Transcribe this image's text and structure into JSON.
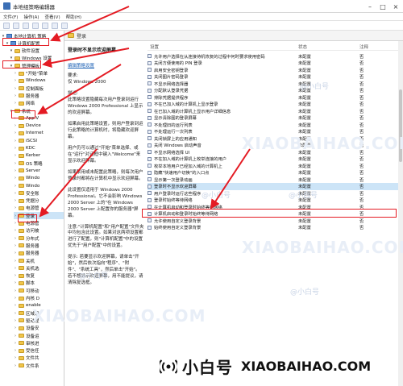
{
  "window": {
    "title": "本地组策略编辑器"
  },
  "menu": [
    "文件(F)",
    "操作(A)",
    "查看(V)",
    "帮助(H)"
  ],
  "tree": {
    "items": [
      {
        "label": "本地计算机 策略",
        "icon": "computer-icon",
        "indent": 0
      },
      {
        "label": "计算机配置",
        "icon": "computer-icon",
        "indent": 1
      },
      {
        "label": "软件设置",
        "icon": "folder-icon",
        "indent": 2
      },
      {
        "label": "Windows 设置",
        "icon": "folder-icon",
        "indent": 2
      },
      {
        "label": "管理模板",
        "icon": "folder-icon",
        "indent": 2
      },
      {
        "label": "\"开始\"菜单",
        "icon": "folder-icon",
        "indent": 3
      },
      {
        "label": "Windows",
        "icon": "folder-icon",
        "indent": 3
      },
      {
        "label": "控制面板",
        "icon": "folder-icon",
        "indent": 3
      },
      {
        "label": "服务器",
        "icon": "folder-icon",
        "indent": 3
      },
      {
        "label": "网络",
        "icon": "folder-icon",
        "indent": 3
      },
      {
        "label": "系统",
        "icon": "folder-icon",
        "indent": 2
      },
      {
        "label": "App-V",
        "icon": "folder-icon",
        "indent": 3
      },
      {
        "label": "Device",
        "icon": "folder-icon",
        "indent": 3
      },
      {
        "label": "Internet",
        "icon": "folder-icon",
        "indent": 3
      },
      {
        "label": "iSCSI",
        "icon": "folder-icon",
        "indent": 3
      },
      {
        "label": "KDC",
        "icon": "folder-icon",
        "indent": 3
      },
      {
        "label": "Kerber",
        "icon": "folder-icon",
        "indent": 3
      },
      {
        "label": "OS 策略",
        "icon": "folder-icon",
        "indent": 3
      },
      {
        "label": "Server",
        "icon": "folder-icon",
        "indent": 3
      },
      {
        "label": "Windo",
        "icon": "folder-icon",
        "indent": 3
      },
      {
        "label": "Windo",
        "icon": "folder-icon",
        "indent": 3
      },
      {
        "label": "安全账",
        "icon": "folder-icon",
        "indent": 3
      },
      {
        "label": "凭据分",
        "icon": "folder-icon",
        "indent": 3
      },
      {
        "label": "电源管",
        "icon": "folder-icon",
        "indent": 3
      },
      {
        "label": "登录",
        "icon": "folder-icon",
        "indent": 3
      },
      {
        "label": "电源管",
        "icon": "folder-icon",
        "indent": 3
      },
      {
        "label": "访问被",
        "icon": "folder-icon",
        "indent": 3
      },
      {
        "label": "分布式",
        "icon": "folder-icon",
        "indent": 3
      },
      {
        "label": "服务器",
        "icon": "folder-icon",
        "indent": 3
      },
      {
        "label": "服务器",
        "icon": "folder-icon",
        "indent": 3
      },
      {
        "label": "关机",
        "icon": "folder-icon",
        "indent": 3
      },
      {
        "label": "关机选",
        "icon": "folder-icon",
        "indent": 3
      },
      {
        "label": "恢复",
        "icon": "folder-icon",
        "indent": 3
      },
      {
        "label": "脚本",
        "icon": "folder-icon",
        "indent": 3
      },
      {
        "label": "可移动",
        "icon": "folder-icon",
        "indent": 3
      },
      {
        "label": "内核 D",
        "icon": "folder-icon",
        "indent": 3
      },
      {
        "label": "enable",
        "icon": "folder-icon",
        "indent": 3
      },
      {
        "label": "区域设",
        "icon": "folder-icon",
        "indent": 3
      },
      {
        "label": "驱动程",
        "icon": "folder-icon",
        "indent": 3
      },
      {
        "label": "设备安",
        "icon": "folder-icon",
        "indent": 3
      },
      {
        "label": "设备运",
        "icon": "folder-icon",
        "indent": 3
      },
      {
        "label": "审核进",
        "icon": "folder-icon",
        "indent": 3
      },
      {
        "label": "受信任",
        "icon": "folder-icon",
        "indent": 3
      },
      {
        "label": "文件共",
        "icon": "folder-icon",
        "indent": 3
      },
      {
        "label": "文件系",
        "icon": "folder-icon",
        "indent": 3
      }
    ]
  },
  "panel_header": {
    "label": "登录"
  },
  "description": {
    "title": "登录时不显示欢迎屏幕",
    "edit_link": "编辑策略设置",
    "req_label": "要求:",
    "req_value": "仅 Windows 2000",
    "desc_label": "描述:",
    "para1": "此策略设置隐藏每次用户登录到运行 Windows 2000 Professional 上显示的欢迎屏幕。",
    "para2": "如果启用此策略设置，则用户登录到运行此策略的计算机时，将隐藏欢迎屏幕。",
    "para3": "用户仍可以通过\"开始\"菜单选择、或在\"运行\"对话框中键入\"Welcome\"来显示欢迎屏幕。",
    "para4": "如果禁用或未配置此策略，则每次用户登录时都将在计算机中显示欢迎屏幕。",
    "para5": "此设置仅适用于 Windows 2000 Professional。它不会影响 Windows 2000 Server 上的\"在 Windows 2000 Server 上配置你的服务器\"屏幕。",
    "para6": "注意:\"计算机配置\"和\"用户配置\"文件夹中均包含此设置。如果对这两项设置都进行了配置，则\"计算机配置\"中的设置优先于\"用户配置\"中的设置。",
    "para7": "提示: 若要显示欢迎屏幕，请单击\"开始\"，然后依次指向\"程序\"、\"附件\"、\"系统工具\"，然后单击\"开始\"。若不想显示欢迎屏幕，用不能提议，请清除复选框。"
  },
  "list": {
    "headers": {
      "setting": "设置",
      "state": "状态",
      "note": "注释"
    },
    "rows": [
      {
        "name": "允许用户选择在从连接待机恢复的过程中何时要求使用密码",
        "state": "未配置",
        "note": "否",
        "selected": false
      },
      {
        "name": "关闭方便使用的 PIN 登录",
        "state": "未配置",
        "note": "否",
        "selected": false
      },
      {
        "name": "启用安全密钥登录",
        "state": "未配置",
        "note": "否",
        "selected": false
      },
      {
        "name": "关闭图片密码登录",
        "state": "未配置",
        "note": "否",
        "selected": false
      },
      {
        "name": "不显示网络选择器",
        "state": "未配置",
        "note": "否",
        "selected": false
      },
      {
        "name": "分配默认登录凭据",
        "state": "未配置",
        "note": "否",
        "selected": false
      },
      {
        "name": "排除凭据提供程序",
        "state": "未配置",
        "note": "否",
        "selected": false
      },
      {
        "name": "不在已加入域的计算机上显示登录",
        "state": "未配置",
        "note": "否",
        "selected": false
      },
      {
        "name": "在已加入域的计算机上显示用户详细信息",
        "state": "未配置",
        "note": "否",
        "selected": false
      },
      {
        "name": "显示清除图的登录屏幕",
        "state": "未配置",
        "note": "否",
        "selected": false
      },
      {
        "name": "不处理旧的运行列表",
        "state": "未配置",
        "note": "否",
        "selected": false
      },
      {
        "name": "不处理运行一次列表",
        "state": "未配置",
        "note": "否",
        "selected": false
      },
      {
        "name": "关闭锁屏上的应用通知",
        "state": "未配置",
        "note": "否",
        "selected": false
      },
      {
        "name": "关闭 Windows 启动声音",
        "state": "未配置",
        "note": "否",
        "selected": false
      },
      {
        "name": "不显示网络选择 UI",
        "state": "未配置",
        "note": "否",
        "selected": false
      },
      {
        "name": "不在加入域的计算机上枚举连接的用户",
        "state": "未配置",
        "note": "否",
        "selected": false
      },
      {
        "name": "枚举本地用户已经加入域的计算机上",
        "state": "未配置",
        "note": "否",
        "selected": false
      },
      {
        "name": "隐藏\"快速用户切换\"的入口点",
        "state": "未配置",
        "note": "否",
        "selected": false
      },
      {
        "name": "显示第一次登录动画",
        "state": "未配置",
        "note": "否",
        "selected": false
      },
      {
        "name": "登录时不显示欢迎屏幕",
        "state": "未配置",
        "note": "否",
        "selected": true
      },
      {
        "name": "用户登录时运行这些程序",
        "state": "未配置",
        "note": "否",
        "selected": false
      },
      {
        "name": "登录时始终等待网络",
        "state": "未配置",
        "note": "否",
        "selected": false
      },
      {
        "name": "在计算机启动和登录时始终等待网络",
        "state": "未配置",
        "note": "否",
        "selected": false
      },
      {
        "name": "计算机启动和登录时始终等待网络",
        "state": "未配置",
        "note": "否",
        "selected": false
      },
      {
        "name": "允许使用自定义登录背景",
        "state": "未配置",
        "note": "否",
        "selected": false
      },
      {
        "name": "始终使用自定义登录背景",
        "state": "未配置",
        "note": "否",
        "selected": false
      }
    ]
  },
  "watermark": {
    "small": "@小白号",
    "big": "XIAOBAIHAO.COM"
  },
  "brand": {
    "cn": "小白号",
    "en": "XIAOBAIHAO.COM"
  },
  "colors": {
    "annotation": "#e41b23",
    "selection": "#cce4f7",
    "link": "#1a5fb4"
  }
}
